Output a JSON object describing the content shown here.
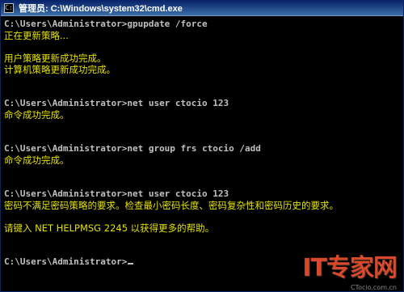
{
  "window": {
    "title": "管理员: C:\\Windows\\system32\\cmd.exe",
    "icon": "console-icon"
  },
  "console": {
    "lines": [
      {
        "kind": "prompt",
        "prompt": "C:\\Users\\Administrator>",
        "command": "gpupdate /force"
      },
      {
        "kind": "out",
        "text": "正在更新策略..."
      },
      {
        "kind": "blank"
      },
      {
        "kind": "out",
        "text": "用户策略更新成功完成。"
      },
      {
        "kind": "out",
        "text": "计算机策略更新成功完成。"
      },
      {
        "kind": "blank"
      },
      {
        "kind": "blank"
      },
      {
        "kind": "prompt",
        "prompt": "C:\\Users\\Administrator>",
        "command": "net user ctocio 123"
      },
      {
        "kind": "out",
        "text": "命令成功完成。"
      },
      {
        "kind": "blank"
      },
      {
        "kind": "blank"
      },
      {
        "kind": "prompt",
        "prompt": "C:\\Users\\Administrator>",
        "command": "net group frs ctocio /add"
      },
      {
        "kind": "out",
        "text": "命令成功完成。"
      },
      {
        "kind": "blank"
      },
      {
        "kind": "blank"
      },
      {
        "kind": "prompt",
        "prompt": "C:\\Users\\Administrator>",
        "command": "net user ctocio 123"
      },
      {
        "kind": "out",
        "text": "密码不满足密码策略的要求。检查最小密码长度、密码复杂性和密码历史的要求。"
      },
      {
        "kind": "blank"
      },
      {
        "kind": "out",
        "text": "请键入 NET HELPMSG 2245 以获得更多的帮助。"
      },
      {
        "kind": "blank"
      },
      {
        "kind": "blank"
      },
      {
        "kind": "prompt",
        "prompt": "C:\\Users\\Administrator>",
        "command": "",
        "cursor": true
      }
    ]
  },
  "watermark": {
    "logo": "IT专家网",
    "sub": "CTocio.com.cn"
  },
  "colors": {
    "background": "#000000",
    "text": "#e5e200",
    "titlebar": "#0a246a"
  }
}
